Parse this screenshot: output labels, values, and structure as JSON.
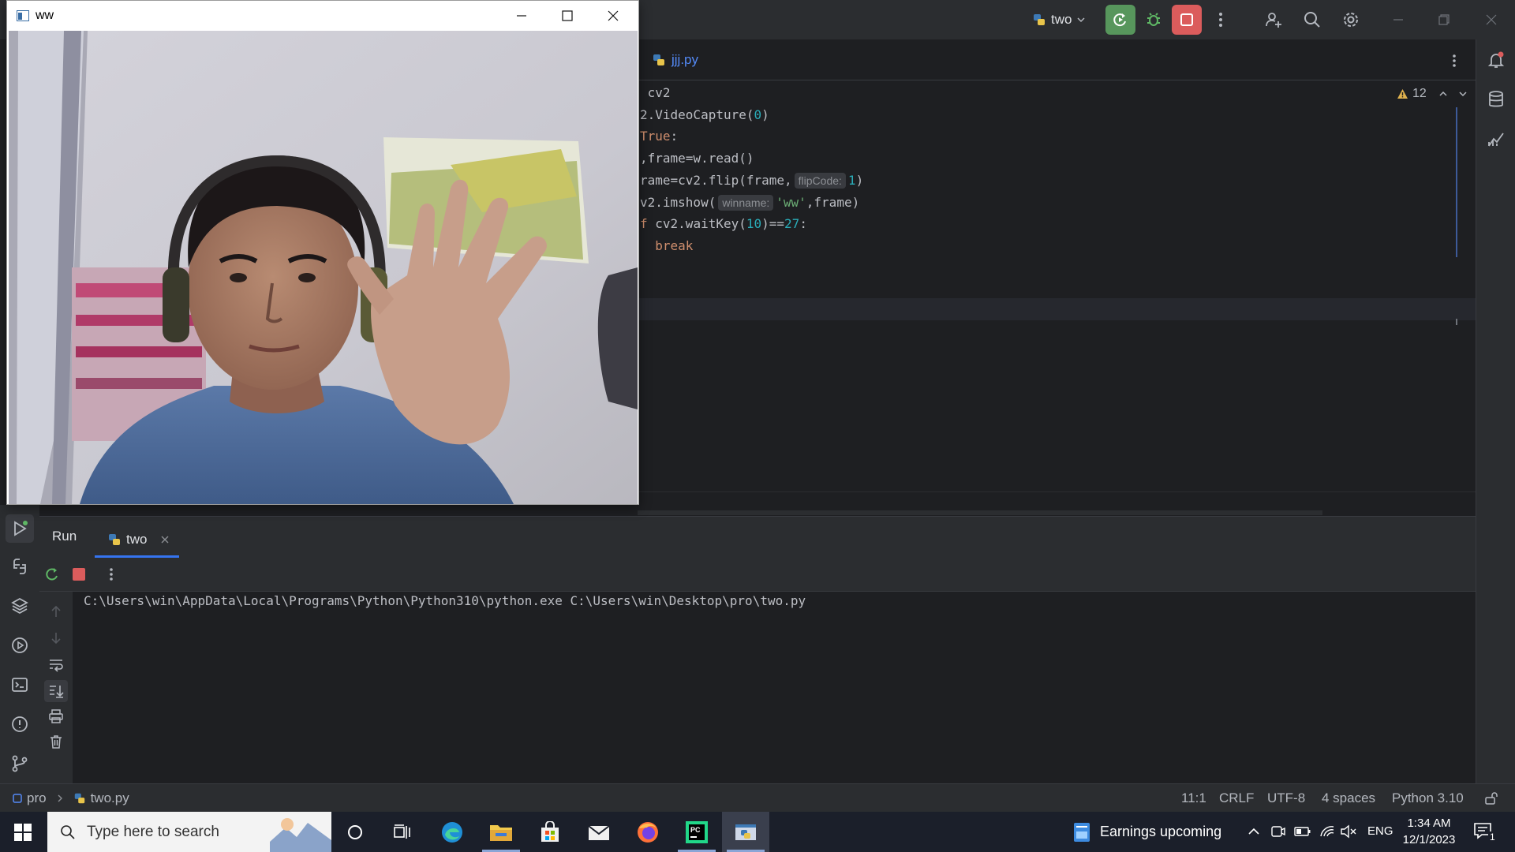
{
  "ide": {
    "run_config": "two",
    "editor_tab": "jjj.py",
    "warnings_count": "12",
    "code": [
      {
        "segments": [
          {
            "t": " cv2",
            "c": ""
          }
        ]
      },
      {
        "segments": [
          {
            "t": "2.VideoCapture(",
            "c": ""
          },
          {
            "t": "0",
            "c": "num"
          },
          {
            "t": ")",
            "c": ""
          }
        ]
      },
      {
        "segments": [
          {
            "t": "True",
            "c": "kw"
          },
          {
            "t": ":",
            "c": ""
          }
        ]
      },
      {
        "segments": [
          {
            "t": ",frame=w.read()",
            "c": ""
          }
        ]
      },
      {
        "segments": [
          {
            "t": "rame=cv2.flip(frame,",
            "c": ""
          },
          {
            "t": "flipCode:",
            "c": "hint"
          },
          {
            "t": "1",
            "c": "num"
          },
          {
            "t": ")",
            "c": ""
          }
        ]
      },
      {
        "segments": [
          {
            "t": "v2.imshow(",
            "c": ""
          },
          {
            "t": "winname:",
            "c": "hint"
          },
          {
            "t": "'ww'",
            "c": "str"
          },
          {
            "t": ",frame)",
            "c": ""
          }
        ]
      },
      {
        "segments": [
          {
            "t": "f",
            "c": "kw"
          },
          {
            "t": " cv2.waitKey(",
            "c": ""
          },
          {
            "t": "10",
            "c": "num"
          },
          {
            "t": ")==",
            "c": ""
          },
          {
            "t": "27",
            "c": "num"
          },
          {
            "t": ":",
            "c": ""
          }
        ]
      },
      {
        "segments": [
          {
            "t": "  ",
            "c": ""
          },
          {
            "t": "break",
            "c": "kw"
          }
        ]
      }
    ],
    "run_panel": {
      "tab_run": "Run",
      "tab_process": "two",
      "console_output": "C:\\Users\\win\\AppData\\Local\\Programs\\Python\\Python310\\python.exe C:\\Users\\win\\Desktop\\pro\\two.py"
    },
    "status": {
      "project": "pro",
      "file": "two.py",
      "position": "11:1",
      "line_sep": "CRLF",
      "encoding": "UTF-8",
      "indent": "4 spaces",
      "interpreter": "Python 3.10"
    },
    "colors": {
      "accent_run": "#57965c",
      "accent_stop": "#db5c5c",
      "bg": "#1e1f22",
      "panel": "#2b2d30"
    }
  },
  "cam_window": {
    "title": "ww"
  },
  "taskbar": {
    "search_placeholder": "Type here to search",
    "news": "Earnings upcoming",
    "language": "ENG",
    "time": "1:34 AM",
    "date": "12/1/2023",
    "notification_count": "1"
  }
}
